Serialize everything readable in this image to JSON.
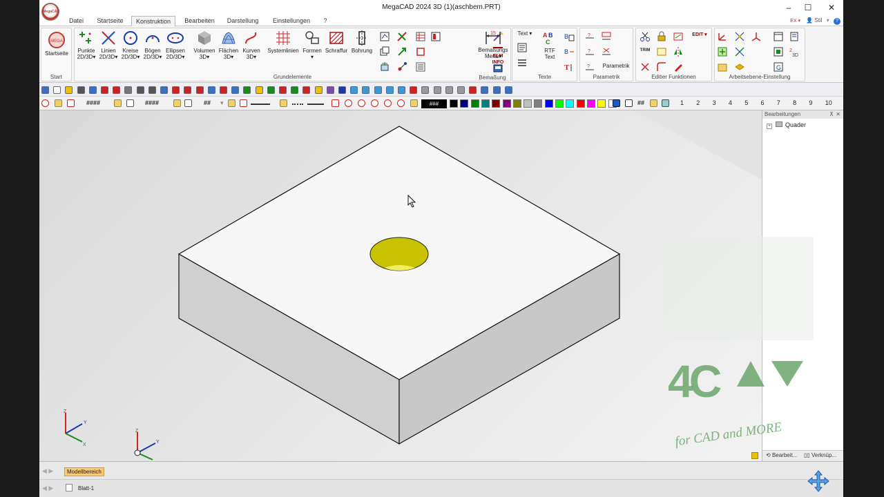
{
  "window": {
    "title": "MegaCAD 2024 3D (1)(aschbem.PRT)"
  },
  "logo_text": "MegaCAD",
  "menu": {
    "tabs": [
      "Datei",
      "Startseite",
      "Konstruktion",
      "Bearbeiten",
      "Darstellung",
      "Einstellungen",
      "?"
    ],
    "active": "Konstruktion",
    "right_label": "Stil"
  },
  "ribbon": {
    "start": {
      "label": "Start",
      "button": "Startseite"
    },
    "grundelemente": {
      "label": "Grundelemente",
      "buttons": [
        {
          "label": "Punkte",
          "sub": "2D/3D"
        },
        {
          "label": "Linien",
          "sub": "2D/3D"
        },
        {
          "label": "Kreise",
          "sub": "2D/3D"
        },
        {
          "label": "Bögen",
          "sub": "2D/3D"
        },
        {
          "label": "Ellipsen",
          "sub": "2D/3D"
        },
        {
          "label": "Volumen",
          "sub": "3D"
        },
        {
          "label": "Flächen",
          "sub": "3D"
        },
        {
          "label": "Kurven",
          "sub": "3D"
        },
        {
          "label": "Systemlinien",
          "sub": ""
        },
        {
          "label": "Formen",
          "sub": ""
        },
        {
          "label": "Schraffur",
          "sub": ""
        },
        {
          "label": "Bohrung",
          "sub": ""
        }
      ],
      "elm_info": "ELM INFO"
    },
    "bemassung": {
      "label": "Bemaßung",
      "button": "Bemaßungs",
      "button_sub": "Menü"
    },
    "texte": {
      "label": "Texte",
      "text_dropdown": "Text",
      "rtf_label": "RTF",
      "rtf_sub": "Text"
    },
    "parametrik": {
      "label": "Parametrik",
      "button": "Parametrik"
    },
    "editier": {
      "label": "Editier Funktionen",
      "edit_label": "EDIT",
      "trim_label": "TRIM"
    },
    "arbeitsebene": {
      "label": "Arbeitsebene-Einstellung"
    }
  },
  "attributes": {
    "hash1": "####",
    "hash2": "####",
    "hash3": "##",
    "hash4": "###",
    "hash5": "##",
    "layers": [
      "1",
      "2",
      "3",
      "4",
      "5",
      "6",
      "7",
      "8",
      "9",
      "10"
    ],
    "colors": [
      "#000000",
      "#000080",
      "#008000",
      "#008080",
      "#800000",
      "#800080",
      "#808000",
      "#c0c0c0",
      "#808080",
      "#0000ff",
      "#00ff00",
      "#00ffff",
      "#ff0000",
      "#ff00ff",
      "#ffff00",
      "#ffffff"
    ]
  },
  "right_panel": {
    "title": "Bearbeitungen",
    "tree_item": "Quader",
    "tab1": "Bearbeit...",
    "tab2": "Verknüp..."
  },
  "watermark": {
    "logo": "4CAD",
    "tagline": "for CAD and MORE"
  },
  "status": {
    "model_tab": "Modellbereich",
    "sheet": "Blatt-1"
  },
  "axes": {
    "x": "X",
    "y": "Y",
    "z": "Z"
  }
}
